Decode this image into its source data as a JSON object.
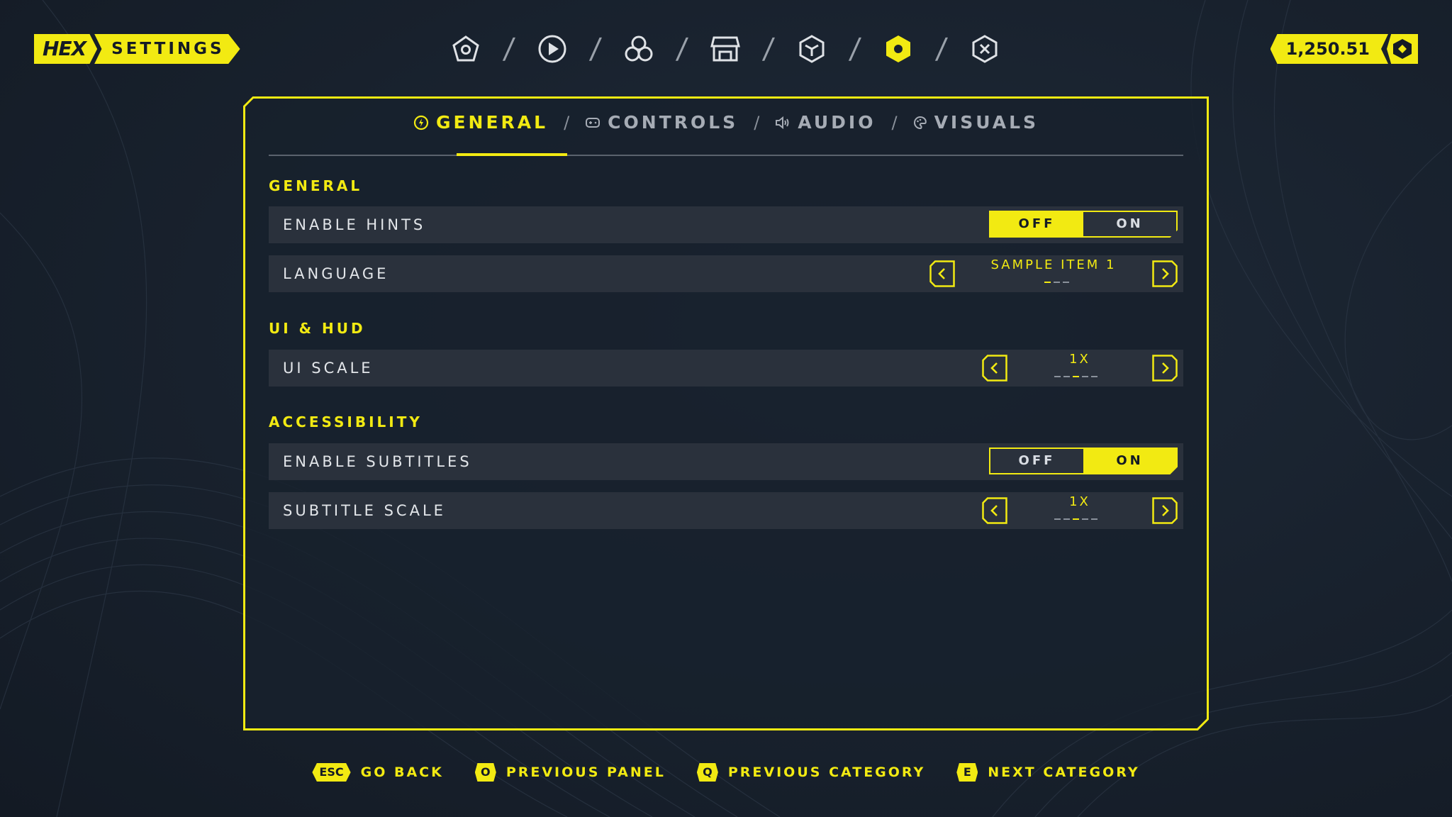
{
  "brand": {
    "logo": "HEX",
    "screen_title": "SETTINGS"
  },
  "topnav": {
    "items": [
      {
        "icon": "home-pentagon-icon"
      },
      {
        "icon": "play-icon"
      },
      {
        "icon": "group-circles-icon"
      },
      {
        "icon": "store-icon"
      },
      {
        "icon": "cube-icon"
      },
      {
        "icon": "settings-hex-icon",
        "active": true
      },
      {
        "icon": "close-hex-icon"
      }
    ],
    "separator": "/"
  },
  "currency": {
    "value": "1,250.51",
    "icon": "coin-hex-icon"
  },
  "tabs": [
    {
      "label": "GENERAL",
      "icon": "bolt-circle-icon",
      "active": true
    },
    {
      "label": "CONTROLS",
      "icon": "gamepad-icon"
    },
    {
      "label": "AUDIO",
      "icon": "speaker-icon"
    },
    {
      "label": "VISUALS",
      "icon": "palette-icon"
    }
  ],
  "tab_separator": "/",
  "sections": {
    "general": "GENERAL",
    "ui_hud": "UI & HUD",
    "accessibility": "ACCESSIBILITY"
  },
  "settings": {
    "enable_hints": {
      "label": "ENABLE HINTS",
      "off": "OFF",
      "on": "ON",
      "value": "OFF"
    },
    "language": {
      "label": "LANGUAGE",
      "value": "SAMPLE ITEM 1",
      "index": 1,
      "count": 3
    },
    "ui_scale": {
      "label": "UI SCALE",
      "value": "1X",
      "index": 3,
      "count": 5
    },
    "enable_subtitles": {
      "label": "ENABLE SUBTITLES",
      "off": "OFF",
      "on": "ON",
      "value": "ON"
    },
    "subtitle_scale": {
      "label": "SUBTITLE SCALE",
      "value": "1X",
      "index": 3,
      "count": 5
    }
  },
  "hints": [
    {
      "key": "ESC",
      "label": "GO BACK"
    },
    {
      "key": "O",
      "label": "PREVIOUS PANEL"
    },
    {
      "key": "Q",
      "label": "PREVIOUS CATEGORY"
    },
    {
      "key": "E",
      "label": "NEXT CATEGORY"
    }
  ],
  "colors": {
    "accent": "#f2ea12",
    "background": "#18212d",
    "row": "#2a313c"
  }
}
